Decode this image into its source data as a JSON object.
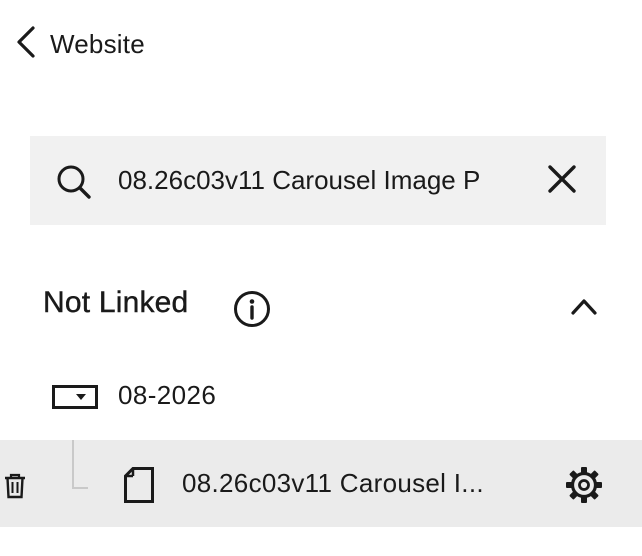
{
  "header": {
    "back_label": "Website",
    "back_icon": "chevron-left-icon"
  },
  "search": {
    "value": "08.26c03v11 Carousel Image P",
    "icon": "search-icon",
    "clear_icon": "close-icon"
  },
  "section": {
    "title": "Not Linked",
    "info_icon": "info-icon",
    "toggle_icon": "chevron-up-icon"
  },
  "tree": {
    "folder": {
      "label": "08-2026",
      "icon": "folder-dropdown-icon"
    },
    "page": {
      "label": "08.26c03v11 Carousel I...",
      "icon": "page-icon",
      "settings_icon": "gear-icon",
      "delete_icon": "trash-icon",
      "selected": true
    }
  },
  "colors": {
    "text": "#1a1a1a",
    "search_bg": "#f1f1f1",
    "selected_row_bg": "#ebebeb"
  }
}
